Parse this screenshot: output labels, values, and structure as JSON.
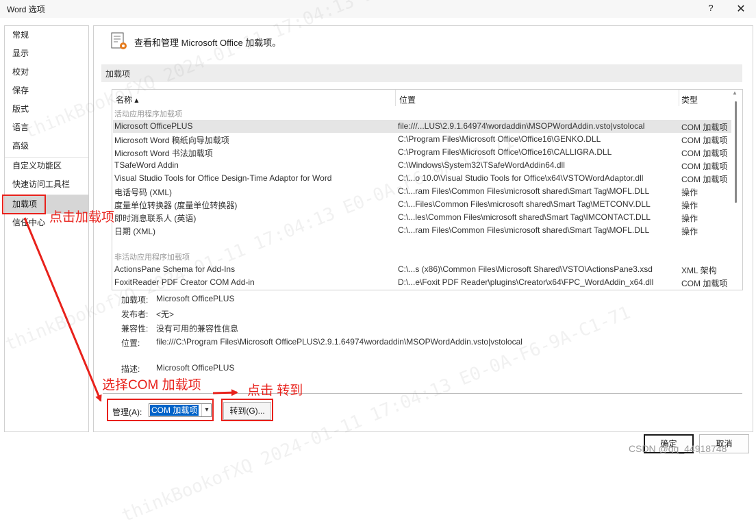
{
  "window": {
    "title": "Word 选项",
    "help_glyph": "?",
    "close_glyph": "✕"
  },
  "sidebar": {
    "items": [
      {
        "label": "常规"
      },
      {
        "label": "显示"
      },
      {
        "label": "校对"
      },
      {
        "label": "保存"
      },
      {
        "label": "版式"
      },
      {
        "label": "语言"
      },
      {
        "label": "高级"
      },
      {
        "label": "自定义功能区"
      },
      {
        "label": "快速访问工具栏"
      },
      {
        "label": "加载项",
        "active": true
      },
      {
        "label": "信任中心"
      }
    ]
  },
  "main": {
    "header": "查看和管理 Microsoft Office 加载项。",
    "section_title": "加载项",
    "columns": {
      "name": "名称 ▴",
      "location": "位置",
      "type": "类型"
    },
    "active_group": "活动应用程序加载项",
    "inactive_group": "非活动应用程序加载项",
    "active_rows": [
      {
        "name": "Microsoft OfficePLUS",
        "location": "file:///...LUS\\2.9.1.64974\\wordaddin\\MSOPWordAddin.vsto|vstolocal",
        "type": "COM 加载项"
      },
      {
        "name": "Microsoft Word 稿纸向导加载项",
        "location": "C:\\Program Files\\Microsoft Office\\Office16\\GENKO.DLL",
        "type": "COM 加载项"
      },
      {
        "name": "Microsoft Word 书法加载项",
        "location": "C:\\Program Files\\Microsoft Office\\Office16\\CALLIGRA.DLL",
        "type": "COM 加载项"
      },
      {
        "name": "TSafeWord Addin",
        "location": "C:\\Windows\\System32\\TSafeWordAddin64.dll",
        "type": "COM 加载项"
      },
      {
        "name": "Visual Studio Tools for Office Design-Time Adaptor for Word",
        "location": "C:\\...o 10.0\\Visual Studio Tools for Office\\x64\\VSTOWordAdaptor.dll",
        "type": "COM 加载项"
      },
      {
        "name": "电话号码 (XML)",
        "location": "C:\\...ram Files\\Common Files\\microsoft shared\\Smart Tag\\MOFL.DLL",
        "type": "操作"
      },
      {
        "name": "度量单位转换器 (度量单位转换器)",
        "location": "C:\\...Files\\Common Files\\microsoft shared\\Smart Tag\\METCONV.DLL",
        "type": "操作"
      },
      {
        "name": "即时消息联系人 (英语)",
        "location": "C:\\...les\\Common Files\\microsoft shared\\Smart Tag\\IMCONTACT.DLL",
        "type": "操作"
      },
      {
        "name": "日期 (XML)",
        "location": "C:\\...ram Files\\Common Files\\microsoft shared\\Smart Tag\\MOFL.DLL",
        "type": "操作"
      }
    ],
    "inactive_rows": [
      {
        "name": "ActionsPane Schema for Add-Ins",
        "location": "C:\\...s (x86)\\Common Files\\Microsoft Shared\\VSTO\\ActionsPane3.xsd",
        "type": "XML 架构"
      },
      {
        "name": "FoxitReader PDF Creator COM Add-in",
        "location": "D:\\...e\\Foxit PDF Reader\\plugins\\Creator\\x64\\FPC_WordAddin_x64.dll",
        "type": "COM 加载项"
      }
    ],
    "details": {
      "addin_label": "加载项:",
      "addin_value": "Microsoft OfficePLUS",
      "publisher_label": "发布者:",
      "publisher_value": "<无>",
      "compat_label": "兼容性:",
      "compat_value": "没有可用的兼容性信息",
      "location_label": "位置:",
      "location_value": "file:///C:\\Program Files\\Microsoft OfficePLUS\\2.9.1.64974\\wordaddin\\MSOPWordAddin.vsto|vstolocal",
      "desc_label": "描述:",
      "desc_value": "Microsoft OfficePLUS"
    },
    "manage_label": "管理(A):",
    "manage_value": "COM 加载项",
    "goto_label": "转到(G)..."
  },
  "footer": {
    "ok_label": "确定",
    "cancel_label": "取消"
  },
  "annotations": {
    "click_addins": "点击加载项",
    "select_com": "选择COM 加载项",
    "click_goto": "点击 转到",
    "color": "#e8211b"
  },
  "csdn_credit": "CSDN @qq_44918748"
}
